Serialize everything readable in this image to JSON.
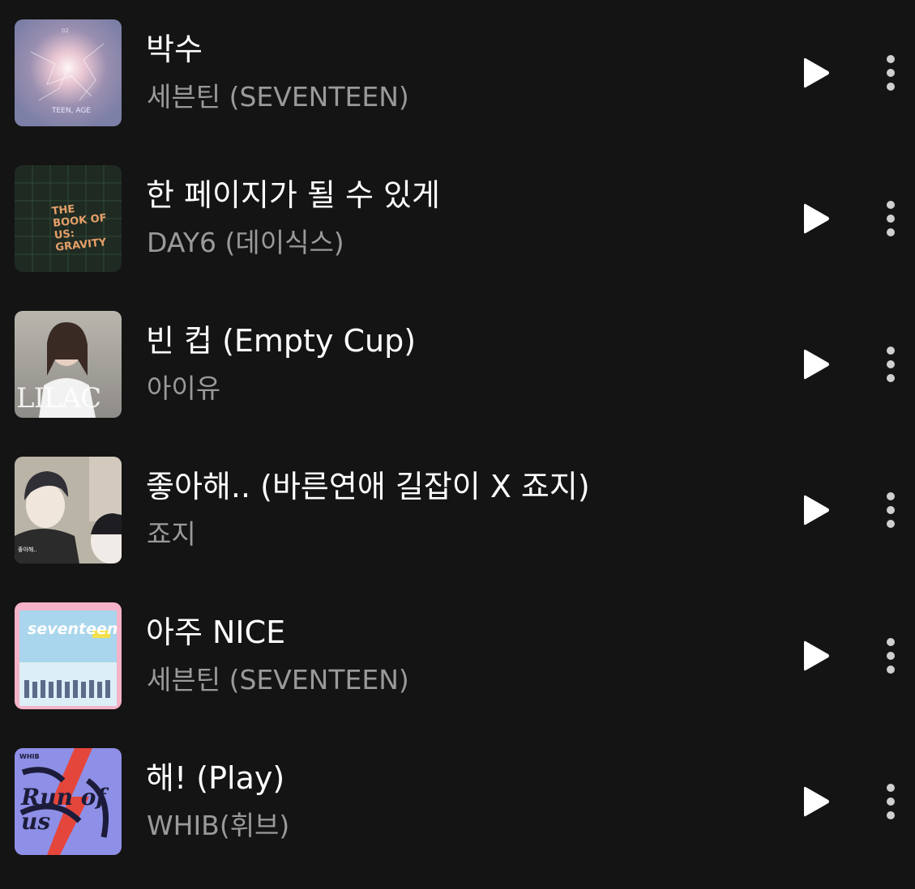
{
  "tracks": [
    {
      "title": "박수",
      "artist": "세븐틴 (SEVENTEEN)",
      "cover_text": "TEEN, AGE",
      "cover_number": "02"
    },
    {
      "title": "한 페이지가 될 수 있게",
      "artist": "DAY6 (데이식스)",
      "cover_text": "THE BOOK OF US: GRAVITY"
    },
    {
      "title": "빈 컵 (Empty Cup)",
      "artist": "아이유",
      "cover_text": "LILAC"
    },
    {
      "title": "좋아해.. (바른연애 길잡이 X 죠지)",
      "artist": "죠지",
      "cover_text": "좋아해.."
    },
    {
      "title": "아주 NICE",
      "artist": "세븐틴 (SEVENTEEN)",
      "cover_text": "seventeen"
    },
    {
      "title": "해! (Play)",
      "artist": "WHIB(휘브)",
      "cover_text": "WHIB",
      "cover_subtext": "Run of us"
    }
  ],
  "icons": {
    "play": "play-icon",
    "more": "more-vertical-icon"
  },
  "colors": {
    "background": "#141414",
    "title": "#ffffff",
    "artist": "#9a9a9a",
    "icon": "#ffffff"
  }
}
